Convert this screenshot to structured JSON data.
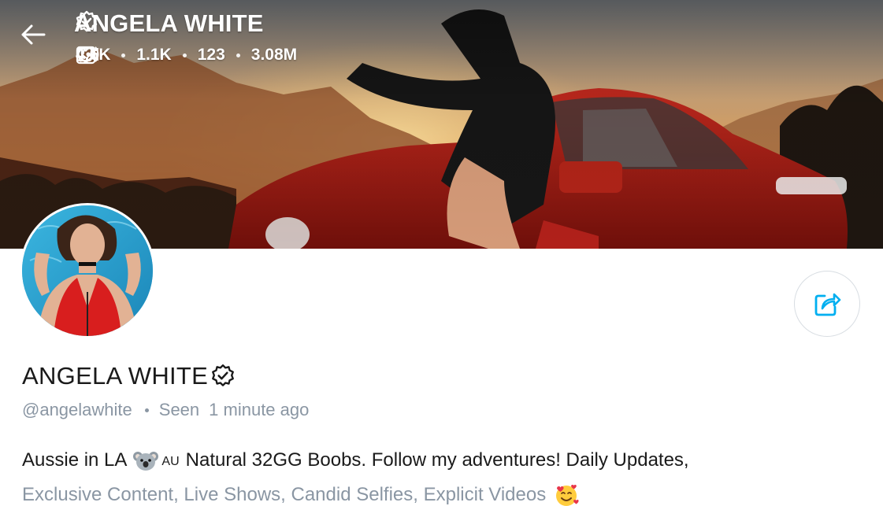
{
  "header": {
    "back_icon": "arrow-left-icon",
    "title": "ANGELA WHITE",
    "verified_icon": "verified-badge-icon",
    "stats": [
      {
        "icon": "image-icon",
        "value": "4.6K"
      },
      {
        "icon": "video-icon",
        "value": "1.1K"
      },
      {
        "icon": "live-broadcast-icon",
        "value": "123"
      },
      {
        "icon": "heart-icon",
        "value": "3.08M"
      }
    ]
  },
  "profile": {
    "name": "ANGELA WHITE",
    "handle": "@angelawhite",
    "seen_label": "Seen",
    "seen_time": "1 minute ago",
    "share_icon": "share-icon",
    "bio": {
      "line1_a": "Aussie in LA",
      "line1_flag": "AU",
      "line1_b": "Natural 32GG Boobs. Follow my adventures! Daily Updates,",
      "line2": "Exclusive Content, Live Shows, Candid Selfies, Explicit Videos"
    }
  },
  "colors": {
    "accent": "#00aff0",
    "muted_text": "#8a96a3",
    "primary_text": "#1a1a1a"
  }
}
